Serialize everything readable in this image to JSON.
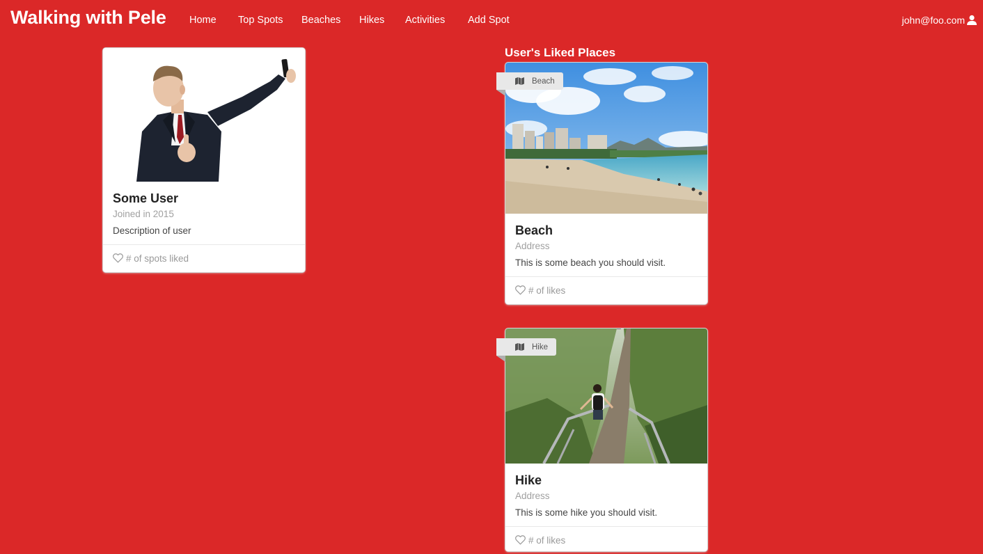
{
  "navbar": {
    "brand": "Walking with Pele",
    "items": [
      {
        "label": "Home"
      },
      {
        "label": "Top Spots"
      },
      {
        "label": "Beaches"
      },
      {
        "label": "Hikes"
      },
      {
        "label": "Activities"
      },
      {
        "label": "Add Spot"
      }
    ],
    "user_email": "john@foo.com",
    "user_icon": "user-icon"
  },
  "profile": {
    "name": "Some User",
    "joined": "Joined in 2015",
    "description": "Description of user",
    "likes_label": "# of spots liked",
    "likes_icon": "heart-outline-icon"
  },
  "liked_places": {
    "title": "User's Liked Places",
    "cards": [
      {
        "tag": "Beach",
        "tag_icon": "map-icon",
        "name": "Beach",
        "address": "Address",
        "description": "This is some beach you should visit.",
        "likes_label": "# of likes"
      },
      {
        "tag": "Hike",
        "tag_icon": "map-icon",
        "name": "Hike",
        "address": "Address",
        "description": "This is some hike you should visit.",
        "likes_label": "# of likes"
      }
    ]
  },
  "colors": {
    "background": "#db2828",
    "card": "#ffffff",
    "ribbon": "#e8e8e8"
  }
}
